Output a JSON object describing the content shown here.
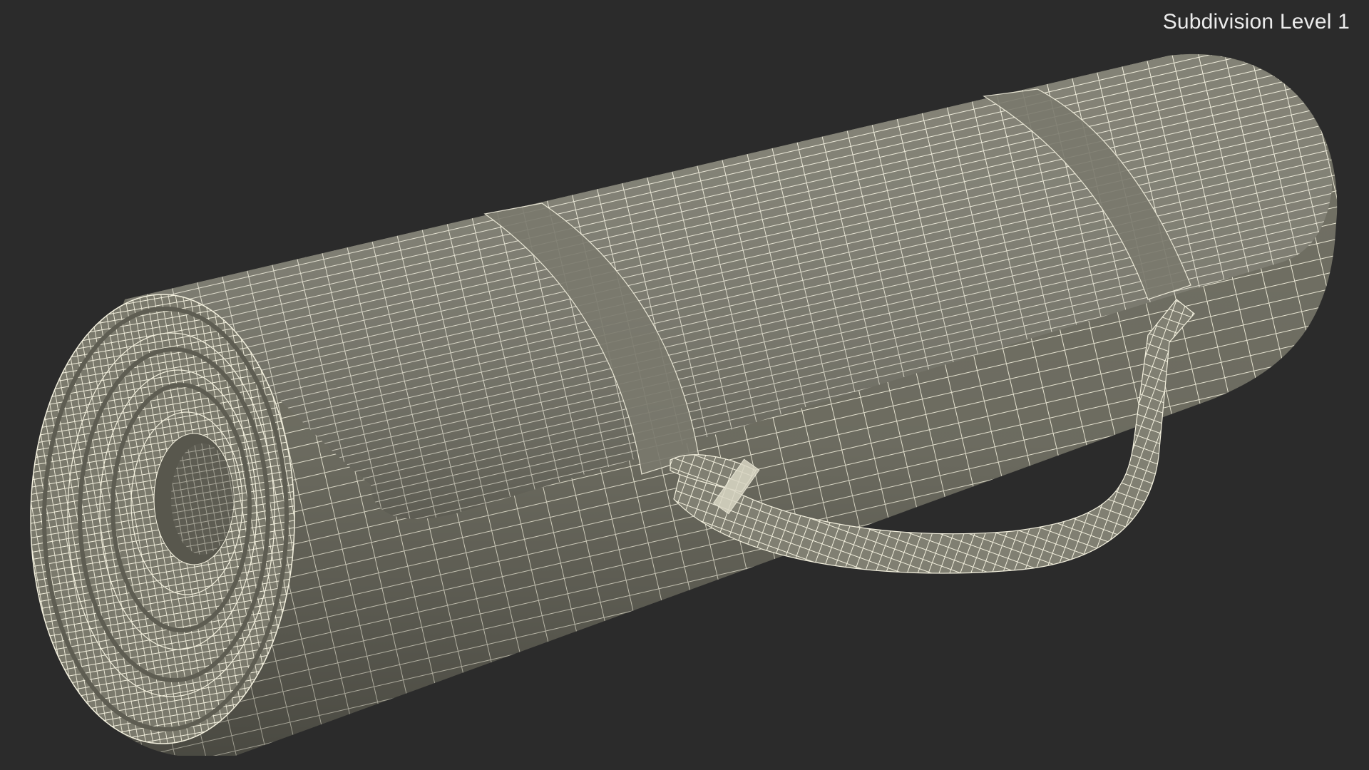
{
  "viewport": {
    "subdivision_label": "Subdivision Level 1",
    "background_color": "#2b2b2b"
  },
  "model": {
    "object": "rolled-yoga-mat-with-carry-strap",
    "display_mode": "wireframe-on-shaded",
    "surface_color": "#7e7d70",
    "shadow_color": "#5b5a50",
    "wire_color": "#f3f0de"
  }
}
